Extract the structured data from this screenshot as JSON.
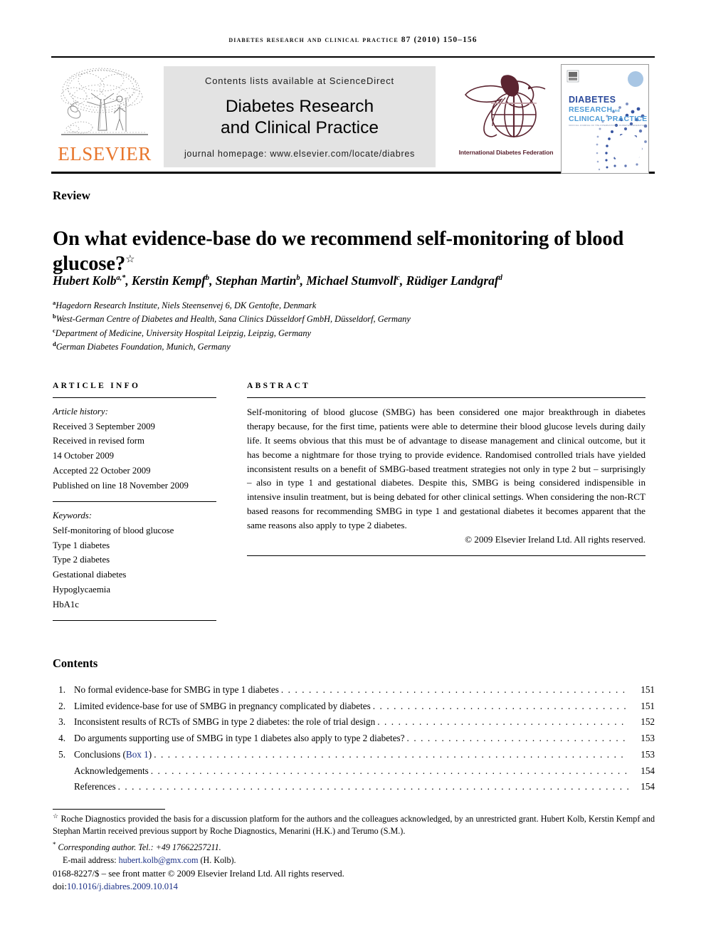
{
  "running_head": "Diabetes Research and Clinical Practice 87 (2010) 150–156",
  "masthead": {
    "publisher_logo_name": "ELSEVIER",
    "sciencedirect_line": "Contents lists available at ScienceDirect",
    "journal_title_line1": "Diabetes Research",
    "journal_title_line2": "and Clinical Practice",
    "homepage_line": "journal homepage: www.elsevier.com/locate/diabres",
    "society_logo_caption": "International Diabetes Federation",
    "cover": {
      "line1": "DIABETES",
      "line2": "RESEARCH",
      "line2_small": "and",
      "line3": "CLINICAL PRACTICE",
      "tagline": "OFFICIAL JOURNAL OF THE INTERNATIONAL DIABETES FEDERATION"
    }
  },
  "article": {
    "doctype": "Review",
    "title": "On what evidence-base do we recommend self-monitoring of blood glucose?",
    "title_footnote_marker": "☆",
    "authors": [
      {
        "name": "Hubert Kolb",
        "marks": "a,*"
      },
      {
        "name": "Kerstin Kempf",
        "marks": "b"
      },
      {
        "name": "Stephan Martin",
        "marks": "b"
      },
      {
        "name": "Michael Stumvoll",
        "marks": "c"
      },
      {
        "name": "Rüdiger Landgraf",
        "marks": "d"
      }
    ],
    "affiliations": [
      {
        "mark": "a",
        "text": "Hagedorn Research Institute, Niels Steensenvej 6, DK Gentofte, Denmark"
      },
      {
        "mark": "b",
        "text": "West-German Centre of Diabetes and Health, Sana Clinics Düsseldorf GmbH, Düsseldorf, Germany"
      },
      {
        "mark": "c",
        "text": "Department of Medicine, University Hospital Leipzig, Leipzig, Germany"
      },
      {
        "mark": "d",
        "text": "German Diabetes Foundation, Munich, Germany"
      }
    ]
  },
  "article_info": {
    "label": "Article info",
    "history_label": "Article history:",
    "history": [
      "Received 3 September 2009",
      "Received in revised form",
      "14 October 2009",
      "Accepted 22 October 2009",
      "Published on line 18 November 2009"
    ],
    "keywords_label": "Keywords:",
    "keywords": [
      "Self-monitoring of blood glucose",
      "Type 1 diabetes",
      "Type 2 diabetes",
      "Gestational diabetes",
      "Hypoglycaemia",
      "HbA1c"
    ]
  },
  "abstract": {
    "label": "Abstract",
    "text": "Self-monitoring of blood glucose (SMBG) has been considered one major breakthrough in diabetes therapy because, for the first time, patients were able to determine their blood glucose levels during daily life. It seems obvious that this must be of advantage to disease management and clinical outcome, but it has become a nightmare for those trying to provide evidence. Randomised controlled trials have yielded inconsistent results on a benefit of SMBG-based treatment strategies not only in type 2 but – surprisingly – also in type 1 and gestational diabetes. Despite this, SMBG is being considered indispensible in intensive insulin treatment, but is being debated for other clinical settings. When considering the non-RCT based reasons for recommending SMBG in type 1 and gestational diabetes it becomes apparent that the same reasons also apply to type 2 diabetes.",
    "copyright": "© 2009 Elsevier Ireland Ltd. All rights reserved."
  },
  "contents": {
    "heading": "Contents",
    "entries": [
      {
        "num": "1.",
        "text": "No formal evidence-base for SMBG in type 1 diabetes",
        "link": "",
        "tail": "",
        "page": "151"
      },
      {
        "num": "2.",
        "text": "Limited evidence-base for use of SMBG in pregnancy complicated by diabetes",
        "link": "",
        "tail": "",
        "page": "151"
      },
      {
        "num": "3.",
        "text": "Inconsistent results of RCTs of SMBG in type 2 diabetes: the role of trial design",
        "link": "",
        "tail": "",
        "page": "152"
      },
      {
        "num": "4.",
        "text": "Do arguments supporting use of SMBG in type 1 diabetes also apply to type 2 diabetes?",
        "link": "",
        "tail": "",
        "page": "153"
      },
      {
        "num": "5.",
        "text": "Conclusions (",
        "link": "Box 1",
        "tail": ")",
        "page": "153"
      },
      {
        "num": "",
        "text": "Acknowledgements",
        "link": "",
        "tail": "",
        "page": "154"
      },
      {
        "num": "",
        "text": "References",
        "link": "",
        "tail": "",
        "page": "154"
      }
    ]
  },
  "footnotes": {
    "star_marker": "☆",
    "star_text": "Roche Diagnostics provided the basis for a discussion platform for the authors and the colleagues acknowledged, by an unrestricted grant. Hubert Kolb, Kerstin Kempf and Stephan Martin received previous support by Roche Diagnostics, Menarini (H.K.) and Terumo (S.M.).",
    "corresponding_marker": "*",
    "corresponding_text": "Corresponding author. Tel.: +49 17662257211.",
    "email_label": "E-mail address:",
    "email": "hubert.kolb@gmx.com",
    "email_suffix": "(H. Kolb)."
  },
  "colophon": {
    "issn_line": "0168-8227/$ – see front matter © 2009 Elsevier Ireland Ltd. All rights reserved.",
    "doi_prefix": "doi:",
    "doi": "10.1016/j.diabres.2009.10.014"
  },
  "colors": {
    "elsevier_orange": "#E8762C",
    "link_blue": "#1a2f86",
    "idf_maroon": "#5b2430",
    "banner_grey": "#e3e3e3",
    "cover_blue": "#2b4a9b",
    "cover_lightblue": "#4d9ad6"
  }
}
